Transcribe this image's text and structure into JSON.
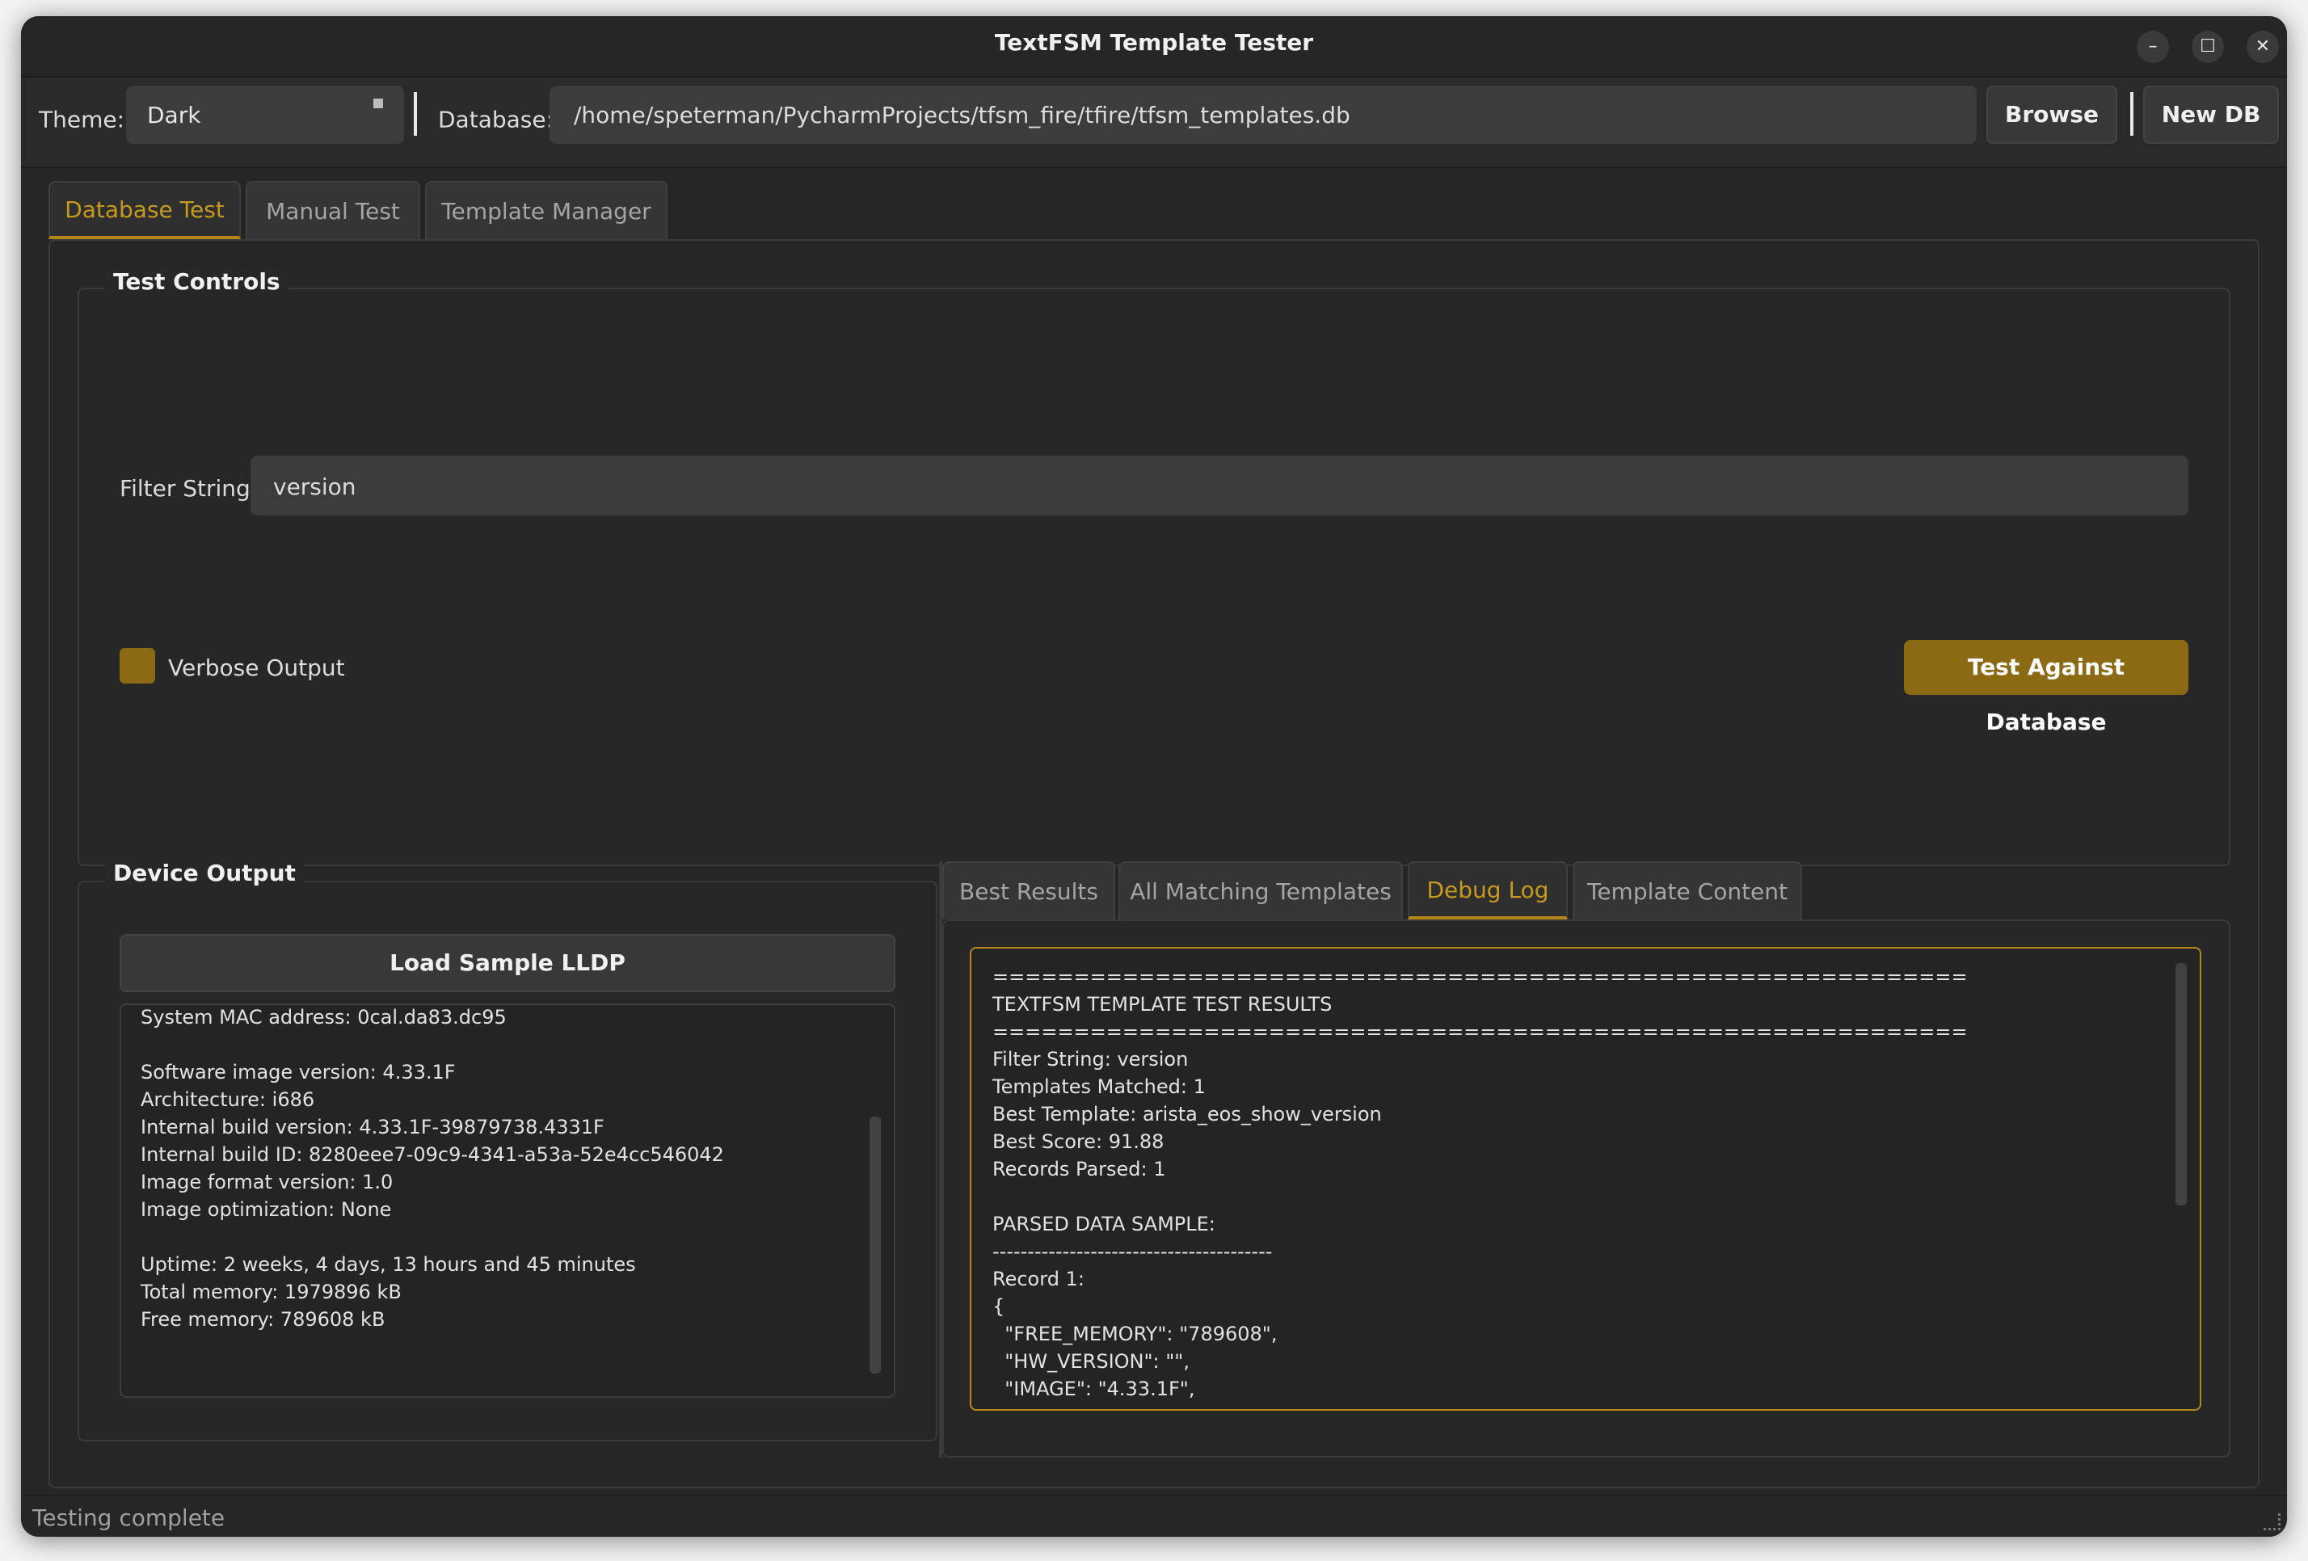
{
  "window": {
    "title": "TextFSM Template Tester"
  },
  "window_controls": {
    "minimize": "–",
    "maximize": "☐",
    "close": "✕"
  },
  "toolbar": {
    "theme_label": "Theme:",
    "theme_value": "Dark",
    "database_label": "Database:",
    "database_path": "/home/speterman/PycharmProjects/tfsm_fire/tfire/tfsm_templates.db",
    "browse_label": "Browse",
    "newdb_label": "New DB"
  },
  "main_tabs": [
    "Database Test",
    "Manual Test",
    "Template Manager"
  ],
  "test_controls": {
    "title": "Test Controls",
    "filter_label": "Filter String:",
    "filter_value": "version",
    "verbose_label": "Verbose Output",
    "verbose_checked": true,
    "test_button": "Test Against Database"
  },
  "device_output": {
    "title": "Device Output",
    "load_button": "Load Sample LLDP",
    "lines": [
      "System MAC address: 0cal.da83.dc95",
      "",
      "Software image version: 4.33.1F",
      "Architecture: i686",
      "Internal build version: 4.33.1F-39879738.4331F",
      "Internal build ID: 8280eee7-09c9-4341-a53a-52e4cc546042",
      "Image format version: 1.0",
      "Image optimization: None",
      "",
      "Uptime: 2 weeks, 4 days, 13 hours and 45 minutes",
      "Total memory: 1979896 kB",
      "Free memory: 789608 kB"
    ]
  },
  "result_tabs": [
    "Best Results",
    "All Matching Templates",
    "Debug Log",
    "Template Content"
  ],
  "debug_log": {
    "lines": [
      "============================================================",
      "TEXTFSM TEMPLATE TEST RESULTS",
      "============================================================",
      "Filter String: version",
      "Templates Matched: 1",
      "Best Template: arista_eos_show_version",
      "Best Score: 91.88",
      "Records Parsed: 1",
      "",
      "PARSED DATA SAMPLE:",
      "----------------------------------------",
      "Record 1:",
      "{",
      "  \"FREE_MEMORY\": \"789608\",",
      "  \"HW_VERSION\": \"\",",
      "  \"IMAGE\": \"4.33.1F\","
    ]
  },
  "status": {
    "text": "Testing complete"
  },
  "colors": {
    "accent": "#8b6a13",
    "accent_text": "#c79a1d",
    "background": "#262626"
  }
}
